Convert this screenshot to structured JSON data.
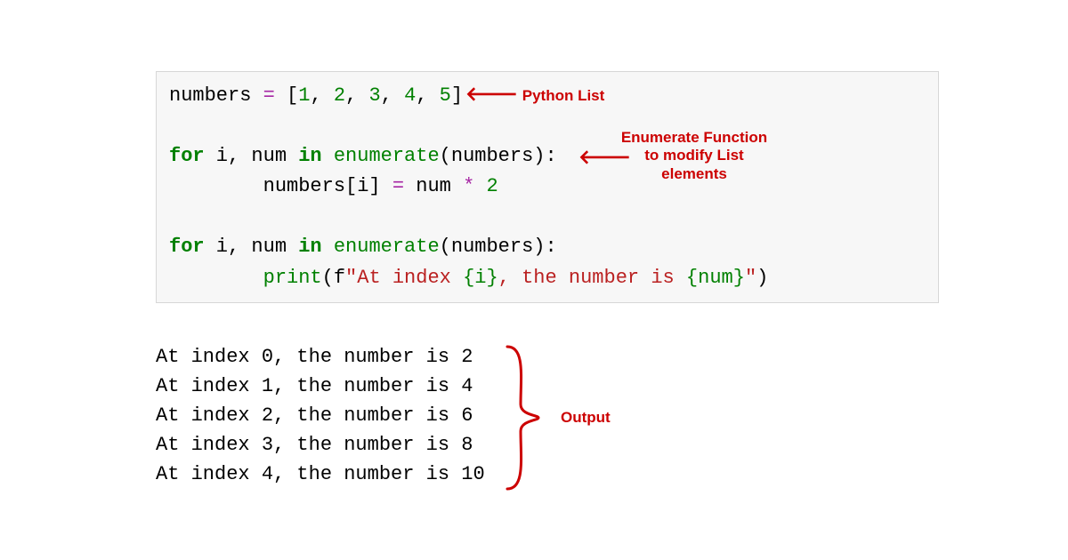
{
  "code": {
    "line1_a": "numbers ",
    "line1_eq": "=",
    "line1_b": " [",
    "line1_n1": "1",
    "line1_c1": ", ",
    "line1_n2": "2",
    "line1_c2": ", ",
    "line1_n3": "3",
    "line1_c3": ", ",
    "line1_n4": "4",
    "line1_c4": ", ",
    "line1_n5": "5",
    "line1_d": "]",
    "line3_for": "for",
    "line3_a": " i, num ",
    "line3_in": "in",
    "line3_b": " ",
    "line3_enum": "enumerate",
    "line3_c": "(numbers):",
    "line4_a": "        numbers[i] ",
    "line4_eq": "=",
    "line4_b": " num ",
    "line4_star": "*",
    "line4_c": " ",
    "line4_n": "2",
    "line6_for": "for",
    "line6_a": " i, num ",
    "line6_in": "in",
    "line6_b": " ",
    "line6_enum": "enumerate",
    "line6_c": "(numbers):",
    "line7_a": "        ",
    "line7_print": "print",
    "line7_b": "(f",
    "line7_s1": "\"At index ",
    "line7_b1": "{i}",
    "line7_s2": ", the number is ",
    "line7_b2": "{num}",
    "line7_s3": "\"",
    "line7_c": ")"
  },
  "output": {
    "l1": "At index 0, the number is 2",
    "l2": "At index 1, the number is 4",
    "l3": "At index 2, the number is 6",
    "l4": "At index 3, the number is 8",
    "l5": "At index 4, the number is 10"
  },
  "annotations": {
    "python_list": "Python List",
    "enumerate_fn_l1": "Enumerate Function",
    "enumerate_fn_l2": "to modify List",
    "enumerate_fn_l3": "elements",
    "output_label": "Output"
  }
}
